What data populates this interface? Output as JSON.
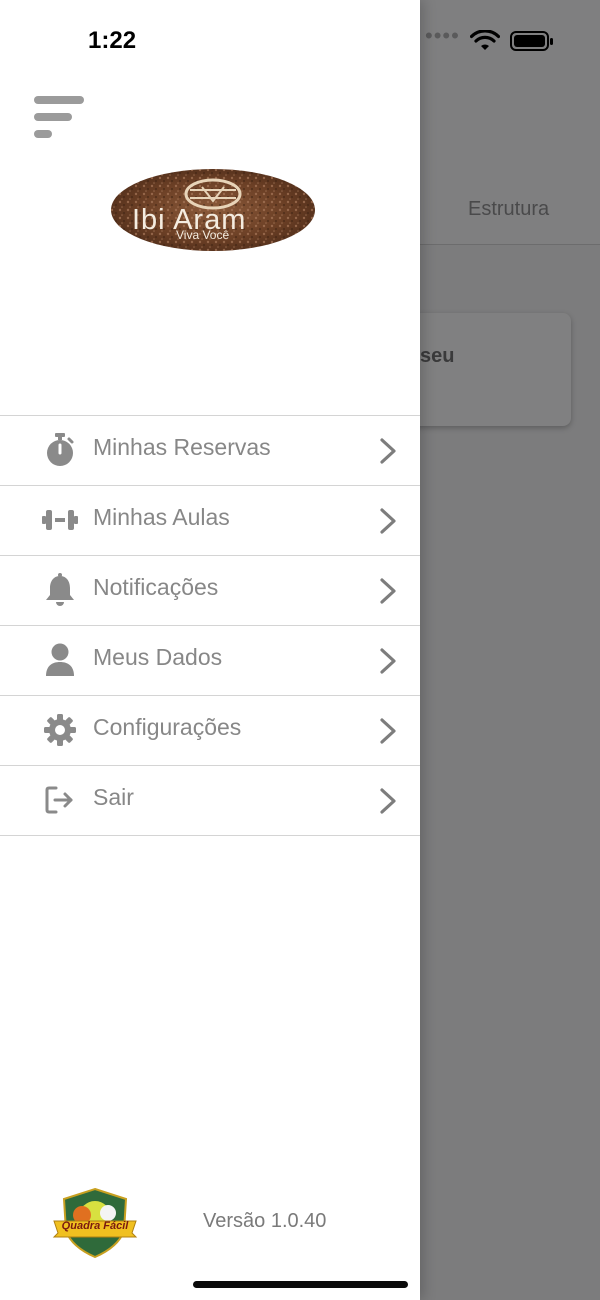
{
  "status_bar": {
    "time": "1:22"
  },
  "background": {
    "tab_label": "Estrutura",
    "card_text": "seu"
  },
  "drawer": {
    "logo": {
      "title": "Ibi Aram",
      "subtitle": "Viva Você"
    },
    "menu_items": [
      {
        "label": "Minhas Reservas",
        "icon": "stopwatch-icon"
      },
      {
        "label": "Minhas Aulas",
        "icon": "dumbbell-icon"
      },
      {
        "label": "Notificações",
        "icon": "bell-icon"
      },
      {
        "label": "Meus Dados",
        "icon": "user-icon"
      },
      {
        "label": "Configurações",
        "icon": "gear-icon"
      },
      {
        "label": "Sair",
        "icon": "logout-icon"
      }
    ],
    "footer": {
      "brand": "Quadra Fácil",
      "version": "Versão 1.0.40"
    }
  }
}
